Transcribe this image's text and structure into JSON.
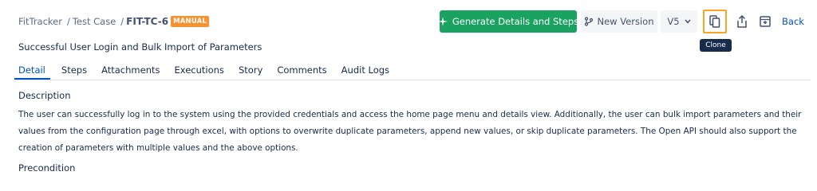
{
  "breadcrumb": {
    "project": "FitTracker",
    "section": "Test Case",
    "separator": "/",
    "key": "FIT-TC-6",
    "badge": "MANUAL"
  },
  "toolbar": {
    "generate_label": "Generate Details and Steps",
    "new_version_label": "New Version",
    "version_value": "V5",
    "back_label": "Back",
    "clone_tooltip": "Clone"
  },
  "colors": {
    "generate_button": "#1aa260",
    "badge": "#f79232",
    "active_tab": "#0052cc",
    "clone_highlight": "#f5a623"
  },
  "icons": {
    "generate": "sparkle-icon",
    "new_version": "version-branch-icon",
    "version_dropdown": "chevron-down-icon",
    "clone": "copy-icon",
    "share": "share-icon",
    "archive": "archive-icon"
  },
  "test_case": {
    "title": "Successful User Login and Bulk Import of Parameters"
  },
  "tabs": [
    {
      "label": "Detail",
      "active": true
    },
    {
      "label": "Steps",
      "active": false
    },
    {
      "label": "Attachments",
      "active": false
    },
    {
      "label": "Executions",
      "active": false
    },
    {
      "label": "Story",
      "active": false
    },
    {
      "label": "Comments",
      "active": false
    },
    {
      "label": "Audit Logs",
      "active": false
    }
  ],
  "detail": {
    "description_label": "Description",
    "description_text": "The user can successfully log in to the system using the provided credentials and access the home page menu and details view. Additionally, the user can bulk import parameters and their values from the configuration page through excel, with options to overwrite duplicate parameters, append new values, or skip duplicate parameters. The Open API should also support the creation of parameters with multiple values and the above options.",
    "precondition_label": "Precondition"
  }
}
